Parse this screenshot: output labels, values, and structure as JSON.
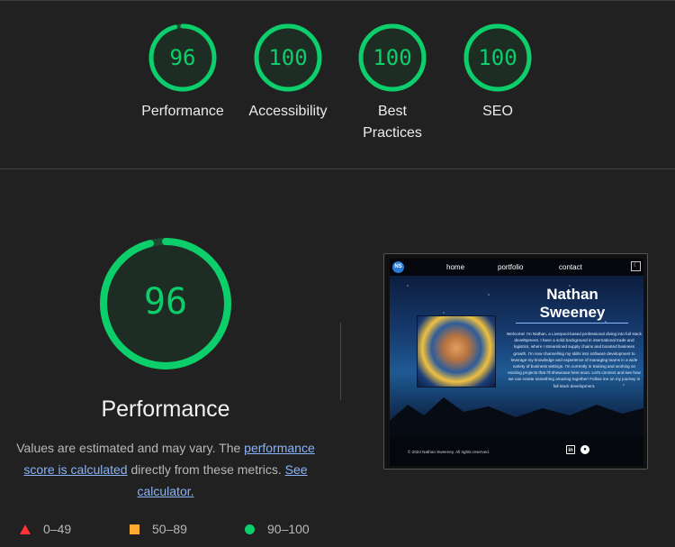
{
  "categories": [
    {
      "score": "96",
      "label": "Performance",
      "fraction": 0.96
    },
    {
      "score": "100",
      "label": "Accessibility",
      "fraction": 1.0
    },
    {
      "score": "100",
      "label": "Best Practices",
      "fraction": 1.0
    },
    {
      "score": "100",
      "label": "SEO",
      "fraction": 1.0
    }
  ],
  "performance": {
    "score": "96",
    "fraction": 0.96,
    "title": "Performance",
    "desc_part1": "Values are estimated and may vary. The",
    "desc_link1": "performance score is calculated",
    "desc_part2": "directly from these metrics.",
    "desc_link2": "See calculator."
  },
  "legend": [
    {
      "shape": "triangle",
      "range": "0–49",
      "color": "#ff3333"
    },
    {
      "shape": "square",
      "range": "50–89",
      "color": "#ffaa33"
    },
    {
      "shape": "circle",
      "range": "90–100",
      "color": "#0cce6b"
    }
  ],
  "colors": {
    "pass": "#0cce6b",
    "background": "#212121"
  },
  "screenshot": {
    "logo": "NS",
    "nav": [
      "home",
      "portfolio",
      "contact"
    ],
    "theme_icon": "☾",
    "name": "Nathan Sweeney",
    "bio": "Welcome! I'm Nathan, a Liverpool-based professional diving into full stack development. I have a solid background in international trade and logistics, where I streamlined supply chains and boosted business growth. I'm now channelling my skills into software development to leverage my knowledge and experience of managing teams in a wide variety of business settings. I'm currently in training and working on exciting projects that I'll showcase here soon. Let's connect and see how we can create something amazing together! Follow me on my journey in full stack development.",
    "footer": "© 2024 Nathan Sweeney. All rights reserved.",
    "linkedin_icon": "in",
    "github_icon": "●"
  }
}
